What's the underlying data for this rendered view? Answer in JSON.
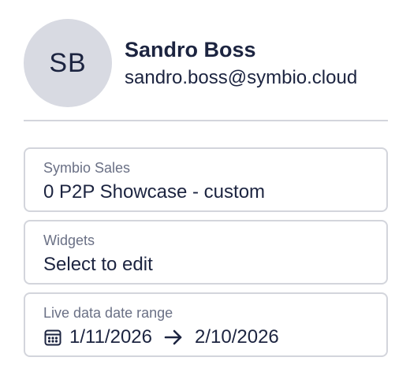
{
  "profile": {
    "initials": "SB",
    "name": "Sandro Boss",
    "email": "sandro.boss@symbio.cloud"
  },
  "fields": {
    "workspace": {
      "label": "Symbio Sales",
      "value": "0 P2P Showcase - custom"
    },
    "widgets": {
      "label": "Widgets",
      "value": "Select to edit"
    },
    "date_range": {
      "label": "Live data date range",
      "start": "1/11/2026",
      "end": "2/10/2026"
    }
  },
  "icons": {
    "calendar": "calendar-icon",
    "arrow": "arrow-right-icon"
  },
  "colors": {
    "text": "#1c2440",
    "muted": "#6a7085",
    "border": "#d3d5dc",
    "avatar_bg": "#d8dae2"
  }
}
